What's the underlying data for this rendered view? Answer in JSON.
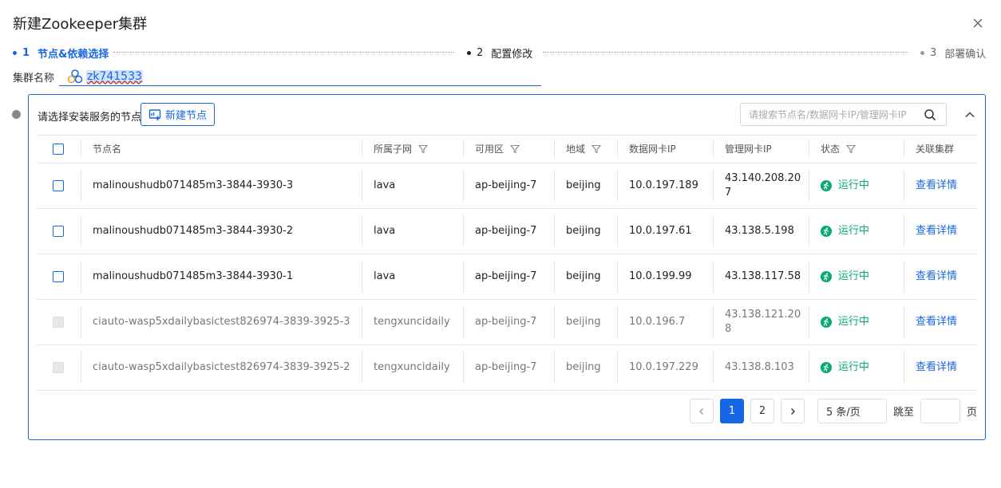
{
  "dialog": {
    "title": "新建Zookeeper集群"
  },
  "steps": [
    {
      "num": "1",
      "label": "节点&依赖选择",
      "state": "active"
    },
    {
      "num": "2",
      "label": "配置修改",
      "state": "normal"
    },
    {
      "num": "3",
      "label": "部署确认",
      "state": "pending"
    }
  ],
  "cluster": {
    "label": "集群名称",
    "value": "zk741533"
  },
  "panel": {
    "title": "请选择安装服务的节点",
    "new_node_label": "新建节点",
    "search_placeholder": "请搜索节点名/数据网卡IP/管理网卡IP"
  },
  "table": {
    "headers": {
      "node": "节点名",
      "subnet": "所属子网",
      "zone": "可用区",
      "region": "地域",
      "data_ip": "数据网卡IP",
      "mgmt_ip": "管理网卡IP",
      "status": "状态",
      "cluster": "关联集群"
    },
    "rows": [
      {
        "node": "malinoushudb071485m3-3844-3930-3",
        "subnet": "lava",
        "zone": "ap-beijing-7",
        "region": "beijing",
        "data_ip": "10.0.197.189",
        "mgmt_ip": "43.140.208.207",
        "status": "运行中",
        "link": "查看详情",
        "disabled": false
      },
      {
        "node": "malinoushudb071485m3-3844-3930-2",
        "subnet": "lava",
        "zone": "ap-beijing-7",
        "region": "beijing",
        "data_ip": "10.0.197.61",
        "mgmt_ip": "43.138.5.198",
        "status": "运行中",
        "link": "查看详情",
        "disabled": false
      },
      {
        "node": "malinoushudb071485m3-3844-3930-1",
        "subnet": "lava",
        "zone": "ap-beijing-7",
        "region": "beijing",
        "data_ip": "10.0.199.99",
        "mgmt_ip": "43.138.117.58",
        "status": "运行中",
        "link": "查看详情",
        "disabled": false
      },
      {
        "node": "ciauto-wasp5xdailybasictest826974-3839-3925-3",
        "subnet": "tengxuncidaily",
        "zone": "ap-beijing-7",
        "region": "beijing",
        "data_ip": "10.0.196.7",
        "mgmt_ip": "43.138.121.208",
        "status": "运行中",
        "link": "查看详情",
        "disabled": true
      },
      {
        "node": "ciauto-wasp5xdailybasictest826974-3839-3925-2",
        "subnet": "tengxuncidaily",
        "zone": "ap-beijing-7",
        "region": "beijing",
        "data_ip": "10.0.197.229",
        "mgmt_ip": "43.138.8.103",
        "status": "运行中",
        "link": "查看详情",
        "disabled": true
      }
    ]
  },
  "pagination": {
    "pages": [
      "1",
      "2"
    ],
    "current": "1",
    "page_size": "5 条/页",
    "jump_label": "跳至",
    "page_suffix": "页"
  },
  "colors": {
    "primary": "#1766e6",
    "success": "#0aa872"
  }
}
